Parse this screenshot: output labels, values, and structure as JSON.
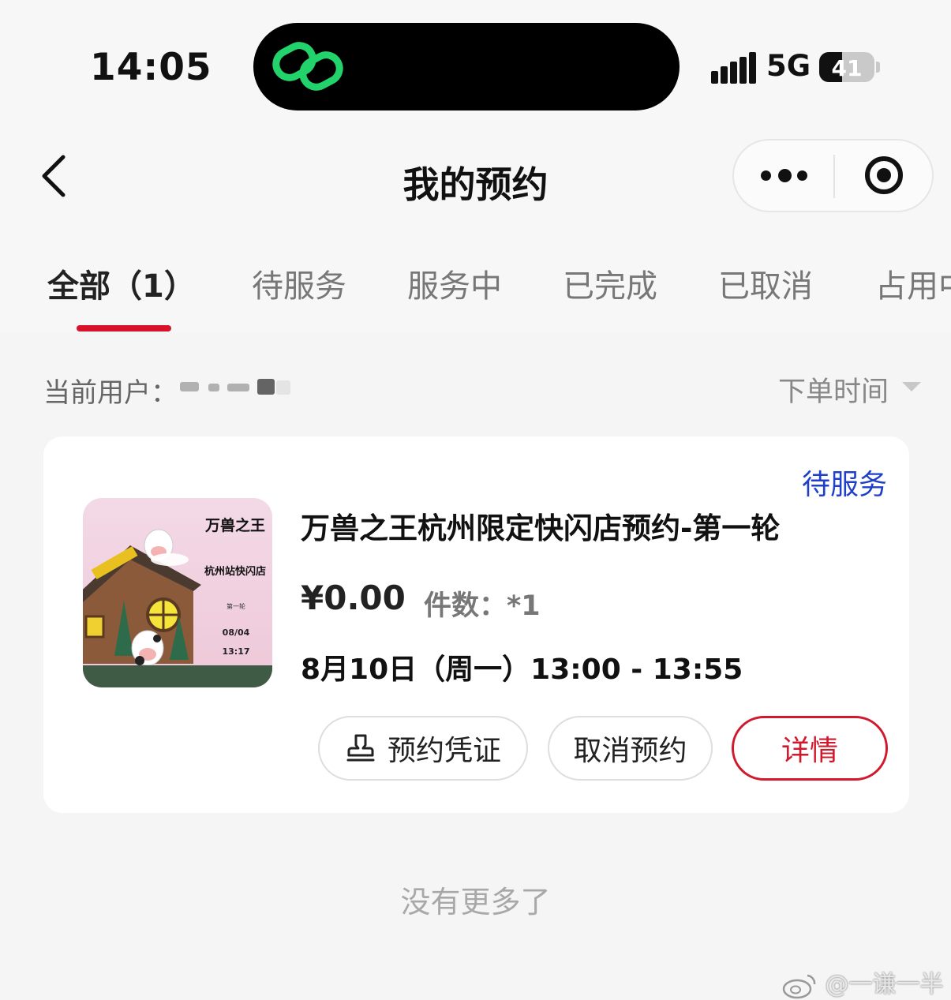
{
  "status_bar": {
    "time": "14:05",
    "network": "5G",
    "battery": "41",
    "battery_level": 0.41
  },
  "nav": {
    "title": "我的预约",
    "back_icon": "chevron-left-icon",
    "more_icon": "more-dots-icon",
    "close_icon": "target-circle-icon"
  },
  "tabs": [
    {
      "label": "全部（1）",
      "active": true
    },
    {
      "label": "待服务"
    },
    {
      "label": "服务中"
    },
    {
      "label": "已完成"
    },
    {
      "label": "已取消"
    },
    {
      "label": "占用中"
    }
  ],
  "filter": {
    "user_label": "当前用户：",
    "sort_label": "下单时间"
  },
  "reservation": {
    "status": "待服务",
    "thumbnail": {
      "logo_text": "万兽之王",
      "store_text": "杭州站快闪店",
      "small_text": "第一轮",
      "date_text": "08/04",
      "time_text": "13:17"
    },
    "title": "万兽之王杭州限定快闪店预约-第一轮",
    "price": "¥0.00",
    "quantity": "件数：*1",
    "datetime": "8月10日（周一）13:00 - 13:55",
    "buttons": {
      "voucher": "预约凭证",
      "cancel": "取消预约",
      "detail": "详情"
    }
  },
  "footer": {
    "no_more": "没有更多了",
    "watermark": "@一谦一半"
  },
  "colors": {
    "accent_red": "#d0192d",
    "status_blue": "#1f3fc8",
    "island_icon_green": "#22d36b"
  }
}
